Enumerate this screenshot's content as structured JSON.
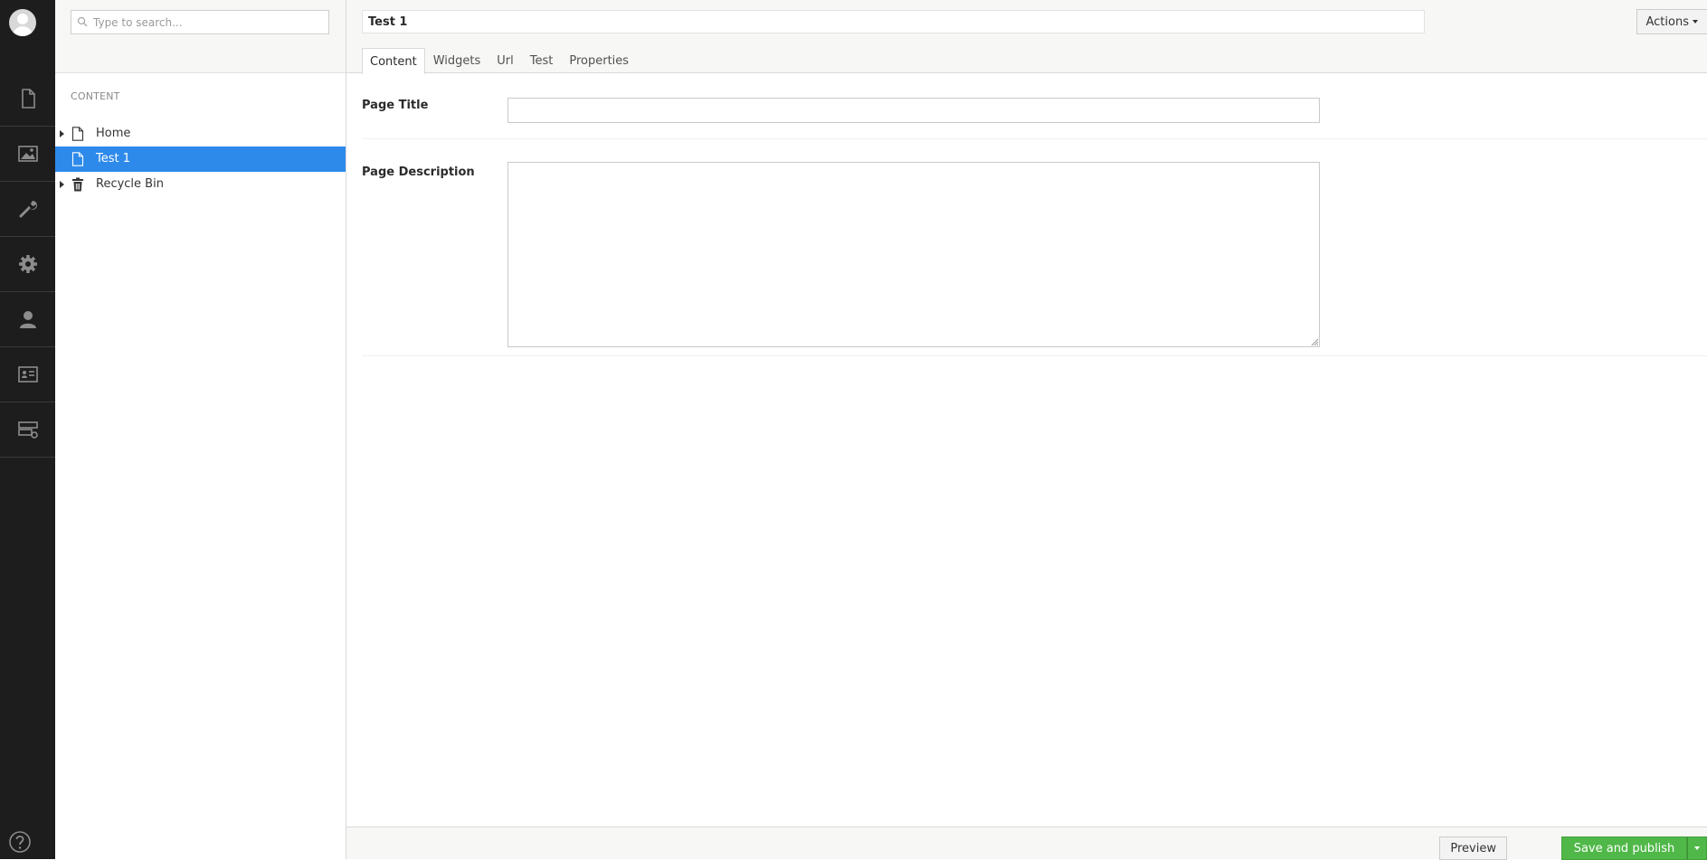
{
  "appbar": {
    "sections": [
      {
        "name": "content",
        "icon": "document-icon"
      },
      {
        "name": "media",
        "icon": "image-icon"
      },
      {
        "name": "developer",
        "icon": "wrench-icon"
      },
      {
        "name": "settings",
        "icon": "gear-icon"
      },
      {
        "name": "users",
        "icon": "user-icon"
      },
      {
        "name": "members",
        "icon": "id-card-icon"
      },
      {
        "name": "forms",
        "icon": "server-settings-icon"
      }
    ],
    "help_icon": "help-icon",
    "avatar_icon": "user-avatar-icon"
  },
  "tree": {
    "search_placeholder": "Type to search...",
    "title": "CONTENT",
    "nodes": [
      {
        "label": "Home",
        "icon": "document-icon",
        "expandable": true,
        "active": false
      },
      {
        "label": "Test 1",
        "icon": "document-icon",
        "expandable": false,
        "active": true
      },
      {
        "label": "Recycle Bin",
        "icon": "trash-icon",
        "expandable": true,
        "active": false
      }
    ]
  },
  "editor": {
    "name_value": "Test 1",
    "actions_label": "Actions",
    "tabs": [
      {
        "label": "Content",
        "active": true
      },
      {
        "label": "Widgets",
        "active": false
      },
      {
        "label": "Url",
        "active": false
      },
      {
        "label": "Test",
        "active": false
      },
      {
        "label": "Properties",
        "active": false
      }
    ],
    "properties": {
      "page_title_label": "Page Title",
      "page_title_value": "",
      "page_description_label": "Page Description",
      "page_description_value": ""
    }
  },
  "footer": {
    "preview_label": "Preview",
    "publish_label": "Save and publish"
  },
  "colors": {
    "appbar_bg": "#1d1d1d",
    "active_node": "#2e8aea",
    "publish": "#50b848"
  }
}
